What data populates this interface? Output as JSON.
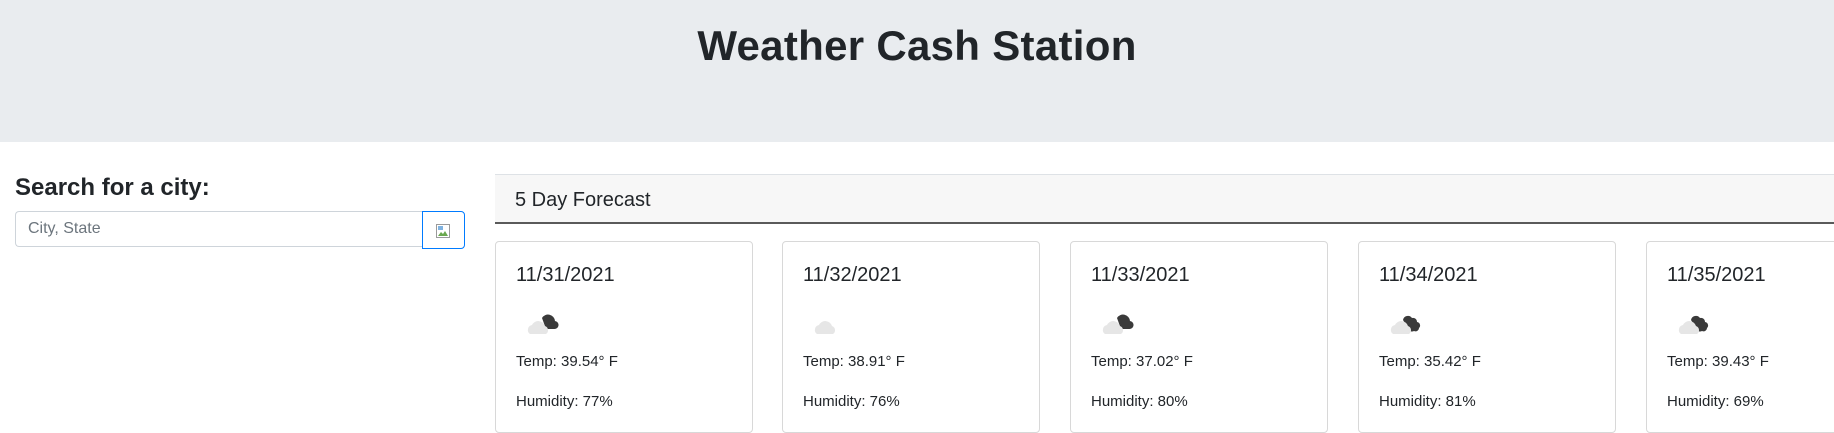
{
  "header": {
    "title": "Weather Cash Station"
  },
  "search": {
    "label": "Search for a city:",
    "placeholder": "City, State",
    "value": "",
    "button_icon": "broken-image-icon"
  },
  "forecast": {
    "title": "5 Day Forecast",
    "days": [
      {
        "date": "11/31/2021",
        "icon": "cloud-with-dark-cloud-icon",
        "temp": "Temp: 39.54° F",
        "humidity": "Humidity: 77%"
      },
      {
        "date": "11/32/2021",
        "icon": "cloud-icon",
        "temp": "Temp: 38.91° F",
        "humidity": "Humidity: 76%"
      },
      {
        "date": "11/33/2021",
        "icon": "cloud-with-dark-cloud-icon",
        "temp": "Temp: 37.02° F",
        "humidity": "Humidity: 80%"
      },
      {
        "date": "11/34/2021",
        "icon": "broken-clouds-icon",
        "temp": "Temp: 35.42° F",
        "humidity": "Humidity: 81%"
      },
      {
        "date": "11/35/2021",
        "icon": "broken-clouds-icon",
        "temp": "Temp: 39.43° F",
        "humidity": "Humidity: 69%"
      }
    ]
  },
  "colors": {
    "header_bg": "#e9ecef",
    "button_border": "#007bff",
    "light_cloud": "#e6e6e6",
    "dark_cloud": "#3a3a3a"
  }
}
